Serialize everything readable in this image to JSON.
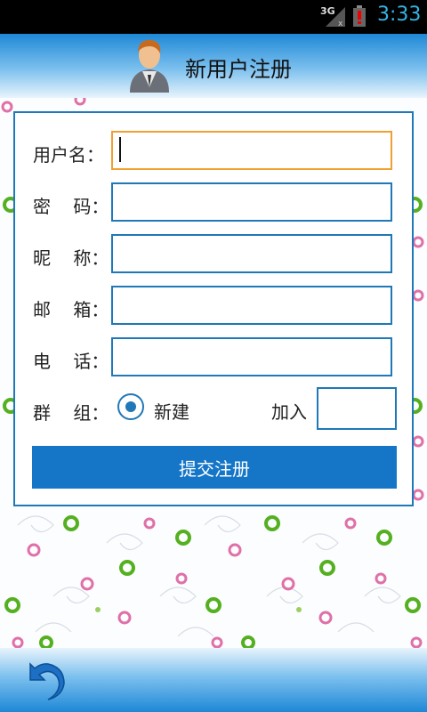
{
  "status_bar": {
    "network": "3G",
    "time": "3:33",
    "battery_alert": "!"
  },
  "header": {
    "title": "新用户注册"
  },
  "form": {
    "username_label": "用户名：",
    "password_label": "密    码：",
    "nickname_label": "昵    称：",
    "email_label": "邮    箱：",
    "phone_label": "电    话：",
    "group_label": "群    组：",
    "username_value": "",
    "password_value": "",
    "nickname_value": "",
    "email_value": "",
    "phone_value": "",
    "group_options": {
      "new_label": "新建",
      "join_label": "加入",
      "selected": "新建"
    },
    "join_value": "",
    "submit_label": "提交注册"
  },
  "colors": {
    "accent": "#1576c8",
    "focus": "#f0a030",
    "border": "#1f78b8"
  },
  "icons": {
    "header": "user-avatar-icon",
    "bottom": "back-arrow-icon"
  }
}
